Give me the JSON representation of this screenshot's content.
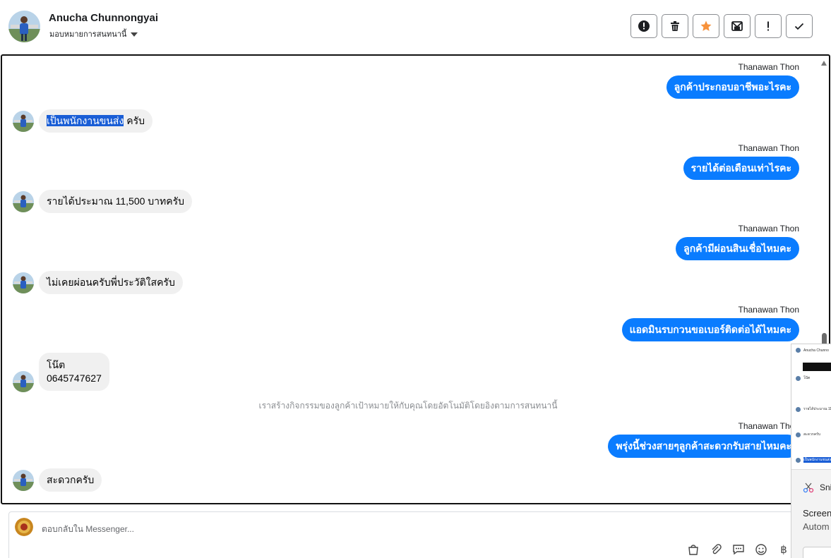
{
  "header": {
    "contact_name": "Anucha Chunnongyai",
    "assign_label": "มอบหมายการสนทนานี้",
    "tools": [
      {
        "name": "report-icon",
        "label": "!"
      },
      {
        "name": "trash-icon",
        "label": "ลบ"
      },
      {
        "name": "star-icon",
        "label": "ติดดาว"
      },
      {
        "name": "mark-unread-icon",
        "label": "ยังไม่ได้อ่าน"
      },
      {
        "name": "follow-up-icon",
        "label": "!"
      },
      {
        "name": "done-icon",
        "label": "เสร็จสิ้น"
      }
    ],
    "star_color": "#f7923b"
  },
  "messages": [
    {
      "type": "outgoing",
      "sender": "Thanawan Thon",
      "text": "ลูกค้าประกอบอาชีพอะไรคะ"
    },
    {
      "type": "incoming",
      "text_highlight": "เป็นพนักงานขนส่ง",
      "text": " ครับ"
    },
    {
      "type": "outgoing",
      "sender": "Thanawan Thon",
      "text": "รายได้ต่อเดือนเท่าไรคะ"
    },
    {
      "type": "incoming",
      "text": "รายได้ประมาณ 11,500 บาทครับ"
    },
    {
      "type": "outgoing",
      "sender": "Thanawan Thon",
      "text": "ลูกค้ามีผ่อนสินเชื่อไหมคะ"
    },
    {
      "type": "incoming",
      "text": "ไม่เคยผ่อนครับพี่ประวัติใสครับ"
    },
    {
      "type": "outgoing",
      "sender": "Thanawan Thon",
      "text": "แอดมินรบกวนขอเบอร์ติดต่อได้ไหมคะ"
    },
    {
      "type": "incoming",
      "line1": "โน๊ต",
      "line2": "0645747627"
    },
    {
      "type": "system",
      "text": "เราสร้างกิจกรรมของลูกค้าเป้าหมายให้กับคุณโดยอัตโนมัติโดยอิงตามการสนทนานี้"
    },
    {
      "type": "outgoing",
      "sender": "Thanawan Thon",
      "text": "พรุ่งนี้ช่วงสายๆลูกค้าสะดวกรับสายไหมคะ"
    },
    {
      "type": "incoming",
      "text": "สะดวกครับ"
    }
  ],
  "colors": {
    "outgoing_bubble": "#0a7cff",
    "incoming_bubble": "#f0f0f0",
    "highlight": "#1a5ed6"
  },
  "composer": {
    "placeholder": "ตอบกลับใน Messenger...",
    "icons": [
      "bag-icon",
      "paperclip-icon",
      "chat-icon",
      "smiley-icon",
      "baht-icon"
    ],
    "baht": "฿"
  },
  "snip_overlay": {
    "app_name": "Sni",
    "title": "Screen",
    "subtitle": "Autom",
    "thumb_name": "Anucha Chunno"
  }
}
